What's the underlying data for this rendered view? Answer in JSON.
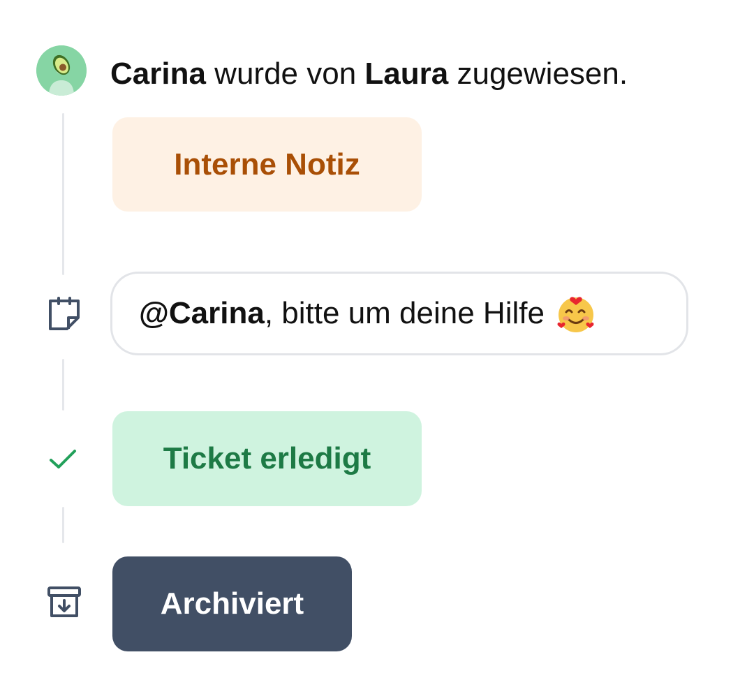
{
  "assignment": {
    "assignee": "Carina",
    "middle": " wurde von ",
    "assigner": "Laura",
    "suffix": " zugewiesen."
  },
  "internal_note": {
    "label": "Interne Notiz",
    "icon": "sticky-note-icon"
  },
  "message": {
    "mention": "@Carina",
    "text": ", bitte um deine Hilfe",
    "emoji": "smiling-face-with-hearts"
  },
  "ticket_done": {
    "label": "Ticket erledigt",
    "icon": "check-icon"
  },
  "archived": {
    "label": "Archiviert",
    "icon": "archive-icon"
  },
  "colors": {
    "note_bg": "#fef1e4",
    "note_text": "#a94f06",
    "done_bg": "#cff3df",
    "done_text": "#1d7a45",
    "archived_bg": "#414f65",
    "icon_slate": "#414f65",
    "check_green": "#22a05a"
  }
}
